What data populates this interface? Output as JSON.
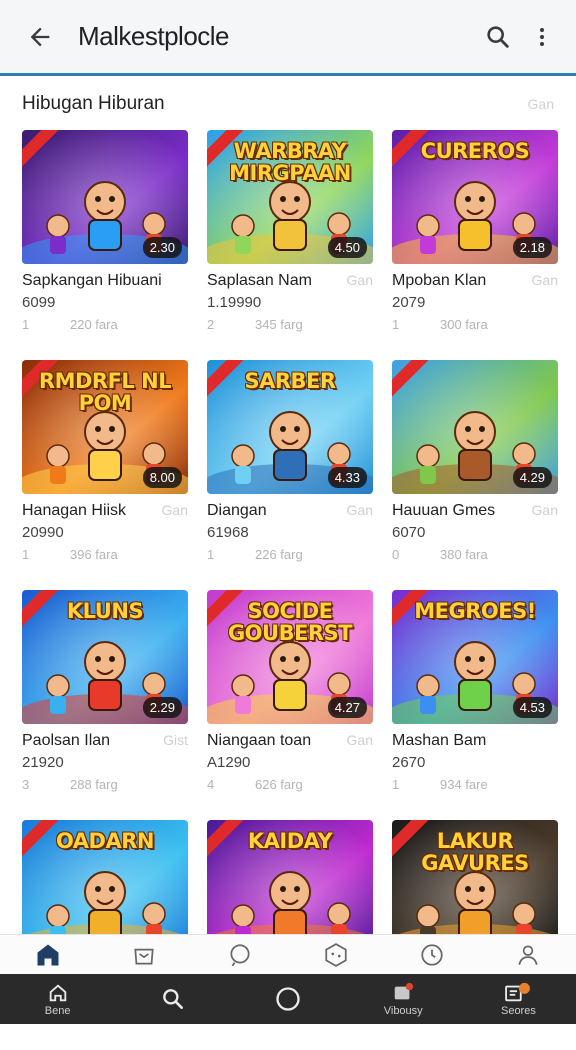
{
  "appbar": {
    "title": "Malkestplocle",
    "back_icon": "arrow-left-icon",
    "search_icon": "search-icon",
    "more_icon": "more-vert-icon"
  },
  "section": {
    "title": "Hibugan Hiburan",
    "link": "Gan"
  },
  "games": [
    {
      "art_text": "",
      "badge": "2.30",
      "name": "Sapkangan Hibuani",
      "price": "",
      "sub": "6099",
      "stat_a": "1",
      "stat_b": "220 fara",
      "theme": [
        "#3a1d6e",
        "#7b2cc9",
        "#2a9df4"
      ]
    },
    {
      "art_text": "WARBRAY MIRGPAAN",
      "badge": "4.50",
      "name": "Saplasan Nam",
      "price": "Gan",
      "sub": "1.19990",
      "stat_a": "2",
      "stat_b": "345 farg",
      "theme": [
        "#2aa0f0",
        "#8fd65a",
        "#f2c23a"
      ]
    },
    {
      "art_text": "CUREROS",
      "badge": "2.18",
      "name": "Mpoban Klan",
      "price": "Gan",
      "sub": "2079",
      "stat_a": "1",
      "stat_b": "300 fara",
      "theme": [
        "#5a1fa8",
        "#c43ad8",
        "#f6c02c"
      ]
    },
    {
      "art_text": "RMDRFL NL POM",
      "badge": "8.00",
      "name": "Hanagan Hiisk",
      "price": "Gan",
      "sub": "20990",
      "stat_a": "1",
      "stat_b": "396 fara",
      "theme": [
        "#8a2a0a",
        "#f07a1a",
        "#ffd04a"
      ]
    },
    {
      "art_text": "SARBER",
      "badge": "4.33",
      "name": "Diangan",
      "price": "Gan",
      "sub": "61968",
      "stat_a": "1",
      "stat_b": "226 farg",
      "theme": [
        "#1f8fd8",
        "#6fd0f4",
        "#2f6fb8"
      ]
    },
    {
      "art_text": "",
      "badge": "4.29",
      "name": "Hauuan Gmes",
      "price": "Gan",
      "sub": "6070",
      "stat_a": "0",
      "stat_b": "380 fara",
      "theme": [
        "#3ea0e8",
        "#7fc84a",
        "#a85a2a"
      ]
    },
    {
      "art_text": "KLUNS",
      "badge": "2.29",
      "name": "Paolsan Ilan",
      "price": "Gist",
      "sub": "21920",
      "stat_a": "3",
      "stat_b": "288 farg",
      "theme": [
        "#1a5ad0",
        "#3ab0f0",
        "#e83a2a"
      ]
    },
    {
      "art_text": "SOCIDE GOUBERST",
      "badge": "4.27",
      "name": "Niangaan toan",
      "price": "Gan",
      "sub": "A1290",
      "stat_a": "4",
      "stat_b": "626 farg",
      "theme": [
        "#c23ad0",
        "#f07ad8",
        "#f6d23a"
      ]
    },
    {
      "art_text": "MEGROES!",
      "badge": "4.53",
      "name": "Mashan Bam",
      "price": "",
      "sub": "2670",
      "stat_a": "1",
      "stat_b": "934 fare",
      "theme": [
        "#7a2ad0",
        "#3a8ff0",
        "#6fd04a"
      ]
    },
    {
      "art_text": "OADARN",
      "badge": "",
      "name": "",
      "price": "",
      "sub": "",
      "stat_a": "",
      "stat_b": "",
      "theme": [
        "#1a7ad8",
        "#3ac0f0",
        "#f0b02a"
      ]
    },
    {
      "art_text": "KAIDAY",
      "badge": "",
      "name": "",
      "price": "",
      "sub": "",
      "stat_a": "",
      "stat_b": "",
      "theme": [
        "#4a1a98",
        "#c02ad0",
        "#f07a2a"
      ]
    },
    {
      "art_text": "LAKUR GAVURES",
      "badge": "",
      "name": "",
      "price": "",
      "sub": "",
      "stat_a": "",
      "stat_b": "",
      "theme": [
        "#1a1a1a",
        "#4a3a2a",
        "#f0a02a"
      ]
    }
  ],
  "tabs": [
    {
      "icon": "home-icon"
    },
    {
      "icon": "store-icon"
    },
    {
      "icon": "chat-icon"
    },
    {
      "icon": "dice-icon"
    },
    {
      "icon": "clock-icon"
    },
    {
      "icon": "person-icon"
    }
  ],
  "sysnav": [
    {
      "icon": "home-icon",
      "label": "Bene"
    },
    {
      "icon": "search-icon",
      "label": ""
    },
    {
      "icon": "circle-icon",
      "label": ""
    },
    {
      "icon": "notification-icon",
      "label": "Vibousy"
    },
    {
      "icon": "games-icon",
      "label": "Seores"
    }
  ],
  "colors": {
    "accent": "#2e7fb8",
    "sysnav_bg": "#2a2a2a"
  }
}
